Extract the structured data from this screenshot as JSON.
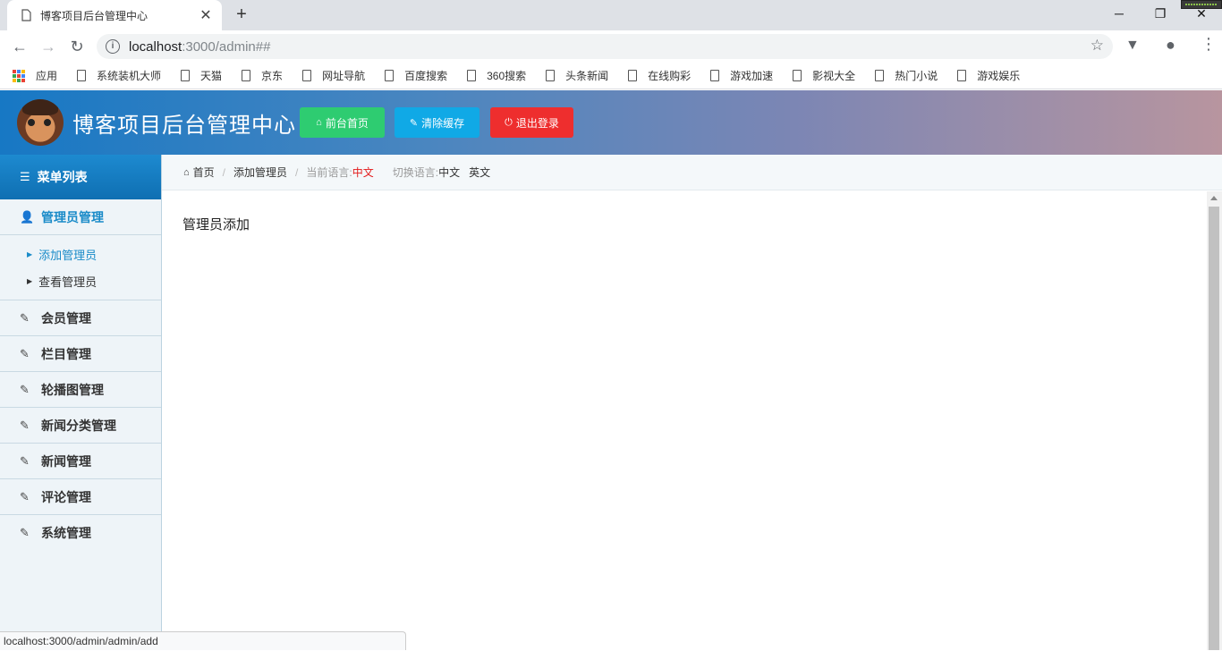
{
  "browser": {
    "tab_title": "博客项目后台管理中心",
    "tab_close": "✕",
    "new_tab": "+",
    "window_controls": {
      "minimize": "─",
      "maximize": "❐",
      "close": "✕"
    },
    "url_host": "localhost",
    "url_path": ":3000/admin##",
    "bookmarks": {
      "apps_label": "应用",
      "items": [
        "系统装机大师",
        "天猫",
        "京东",
        "网址导航",
        "百度搜索",
        "360搜索",
        "头条新闻",
        "在线购彩",
        "游戏加速",
        "影视大全",
        "热门小说",
        "游戏娱乐"
      ]
    },
    "status_url": "localhost:3000/admin/admin/add"
  },
  "header": {
    "site_title": "博客项目后台管理中心",
    "buttons": {
      "home": "前台首页",
      "clear_cache": "清除缓存",
      "logout": "退出登录"
    },
    "colors": {
      "home": "#2ecc71",
      "clear_cache": "#10a9e6",
      "logout": "#ee2e2e"
    }
  },
  "sidebar": {
    "heading": "菜单列表",
    "active_menu": "管理员管理",
    "sub_items": [
      "添加管理员",
      "查看管理员"
    ],
    "menu_items": [
      "会员管理",
      "栏目管理",
      "轮播图管理",
      "新闻分类管理",
      "新闻管理",
      "评论管理",
      "系统管理"
    ]
  },
  "breadcrumb": {
    "home": "首页",
    "current": "添加管理员",
    "lang_label": "当前语言:",
    "lang_value": "中文",
    "switch_label": "切换语言:",
    "switch_zh": "中文",
    "switch_en": "英文"
  },
  "main": {
    "page_title": "管理员添加"
  }
}
